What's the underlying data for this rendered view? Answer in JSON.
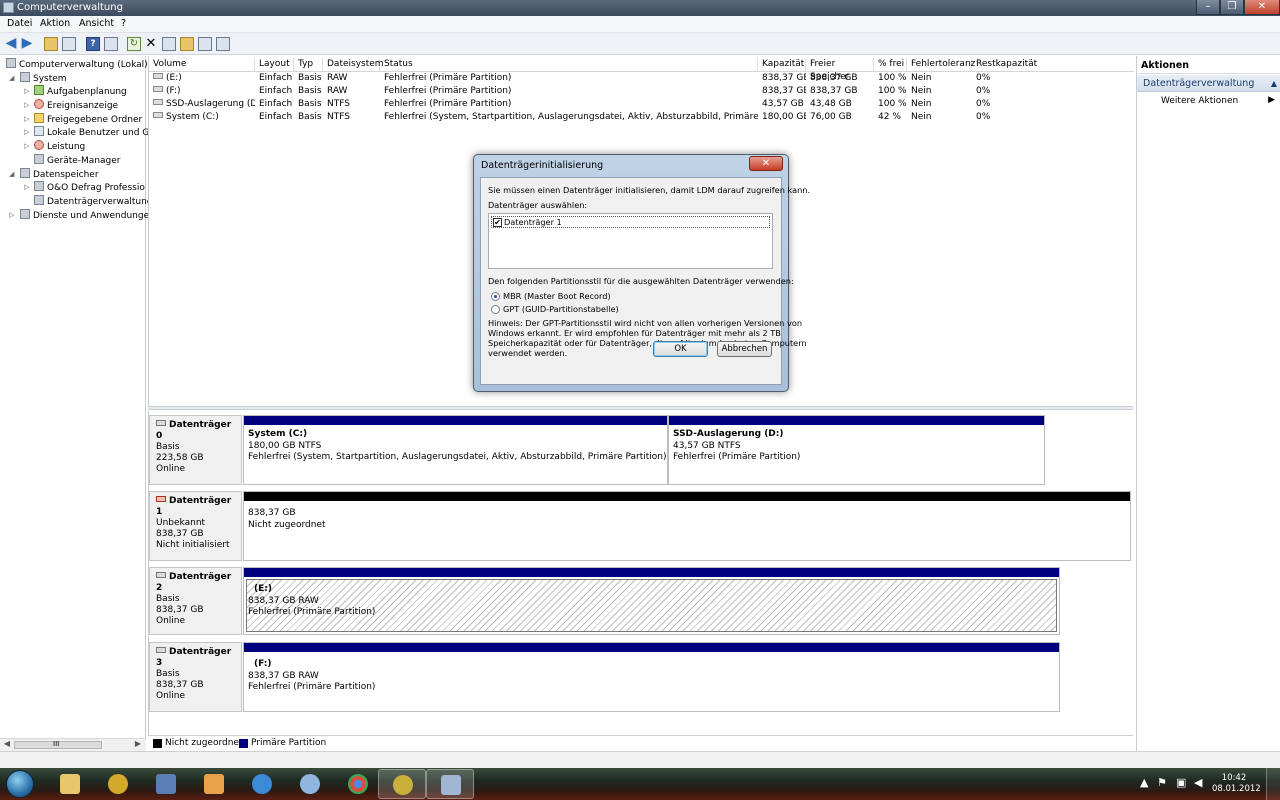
{
  "window": {
    "title": "Computerverwaltung",
    "controls": [
      "–",
      "❐",
      "✕"
    ]
  },
  "menu": [
    "Datei",
    "Aktion",
    "Ansicht",
    "?"
  ],
  "tree": {
    "items": [
      {
        "label": "Computerverwaltung (Lokal)",
        "level": 0
      },
      {
        "label": "System",
        "level": 1
      },
      {
        "label": "Aufgabenplanung",
        "level": 2
      },
      {
        "label": "Ereignisanzeige",
        "level": 2
      },
      {
        "label": "Freigegebene Ordner",
        "level": 2
      },
      {
        "label": "Lokale Benutzer und Gru",
        "level": 2
      },
      {
        "label": "Leistung",
        "level": 2
      },
      {
        "label": "Geräte-Manager",
        "level": 2
      },
      {
        "label": "Datenspeicher",
        "level": 1
      },
      {
        "label": "O&O Defrag Professio",
        "level": 2
      },
      {
        "label": "Datenträgerverwaltung",
        "level": 2
      },
      {
        "label": "Dienste und Anwendungen",
        "level": 1
      }
    ],
    "scroll_label": "III"
  },
  "volumes": {
    "columns": [
      "Volume",
      "Layout",
      "Typ",
      "Dateisystem",
      "Status",
      "Kapazität",
      "Freier Speicher",
      "% frei",
      "Fehlertoleranz",
      "Restkapazität"
    ],
    "rows": [
      [
        "(E:)",
        "Einfach",
        "Basis",
        "RAW",
        "Fehlerfrei (Primäre Partition)",
        "838,37 GB",
        "838,37 GB",
        "100 %",
        "Nein",
        "0%"
      ],
      [
        "(F:)",
        "Einfach",
        "Basis",
        "RAW",
        "Fehlerfrei (Primäre Partition)",
        "838,37 GB",
        "838,37 GB",
        "100 %",
        "Nein",
        "0%"
      ],
      [
        "SSD-Auslagerung (D:)",
        "Einfach",
        "Basis",
        "NTFS",
        "Fehlerfrei (Primäre Partition)",
        "43,57 GB",
        "43,48 GB",
        "100 %",
        "Nein",
        "0%"
      ],
      [
        "System (C:)",
        "Einfach",
        "Basis",
        "NTFS",
        "Fehlerfrei (System, Startpartition, Auslagerungsdatei, Aktiv, Absturzabbild, Primäre Partition)",
        "180,00 GB",
        "76,00 GB",
        "42 %",
        "Nein",
        "0%"
      ]
    ]
  },
  "disks": [
    {
      "name": "Datenträger 0",
      "lines": [
        "Basis",
        "223,58 GB",
        "Online"
      ],
      "partitions": [
        {
          "name": "System  (C:)",
          "lines": [
            "180,00 GB NTFS",
            "Fehlerfrei (System, Startpartition, Auslagerungsdatei, Aktiv, Absturzabbild, Primäre Partition)"
          ]
        },
        {
          "name": "SSD-Auslagerung  (D:)",
          "lines": [
            "43,57 GB NTFS",
            "Fehlerfrei (Primäre Partition)"
          ]
        }
      ]
    },
    {
      "name": "Datenträger 1",
      "lines": [
        "Unbekannt",
        "838,37 GB",
        "Nicht initialisiert"
      ],
      "partitions": [
        {
          "name": "",
          "lines": [
            "838,37 GB",
            "Nicht zugeordnet"
          ]
        }
      ]
    },
    {
      "name": "Datenträger 2",
      "lines": [
        "Basis",
        "838,37 GB",
        "Online"
      ],
      "partitions": [
        {
          "name": "(E:)",
          "lines": [
            "838,37 GB RAW",
            "Fehlerfrei (Primäre Partition)"
          ]
        }
      ]
    },
    {
      "name": "Datenträger 3",
      "lines": [
        "Basis",
        "838,37 GB",
        "Online"
      ],
      "partitions": [
        {
          "name": "(F:)",
          "lines": [
            "838,37 GB RAW",
            "Fehlerfrei (Primäre Partition)"
          ]
        }
      ]
    }
  ],
  "legend": {
    "unallocated": "Nicht zugeordnet",
    "primary": "Primäre Partition",
    "unallocated_color": "#000000",
    "primary_color": "#00007e"
  },
  "actions": {
    "header": "Aktionen",
    "section": "Datenträgerverwaltung",
    "item": "Weitere Aktionen"
  },
  "dialog": {
    "title": "Datenträgerinitialisierung",
    "intro": "Sie müssen einen Datenträger initialisieren, damit LDM darauf zugreifen kann.",
    "select_label": "Datenträger auswählen:",
    "disk_item": "Datenträger 1",
    "disk_checked": true,
    "style_label": "Den folgenden Partitionsstil für die ausgewählten Datenträger verwenden:",
    "option_mbr": "MBR (Master Boot Record)",
    "option_gpt": "GPT (GUID-Partitionstabelle)",
    "selected_option": "MBR (Master Boot Record)",
    "hint_lines": [
      "Hinweis: Der GPT-Partitionsstil wird nicht von allen vorherigen Versionen von",
      "Windows erkannt. Er wird empfohlen für Datenträger mit mehr als 2 TB",
      "Speicherkapazität oder für Datenträger, die auf Itanium-basierten Computern",
      "verwendet werden."
    ],
    "ok": "OK",
    "cancel": "Abbrechen"
  },
  "taskbar": {
    "time": "10:42",
    "date": "08.01.2012"
  }
}
